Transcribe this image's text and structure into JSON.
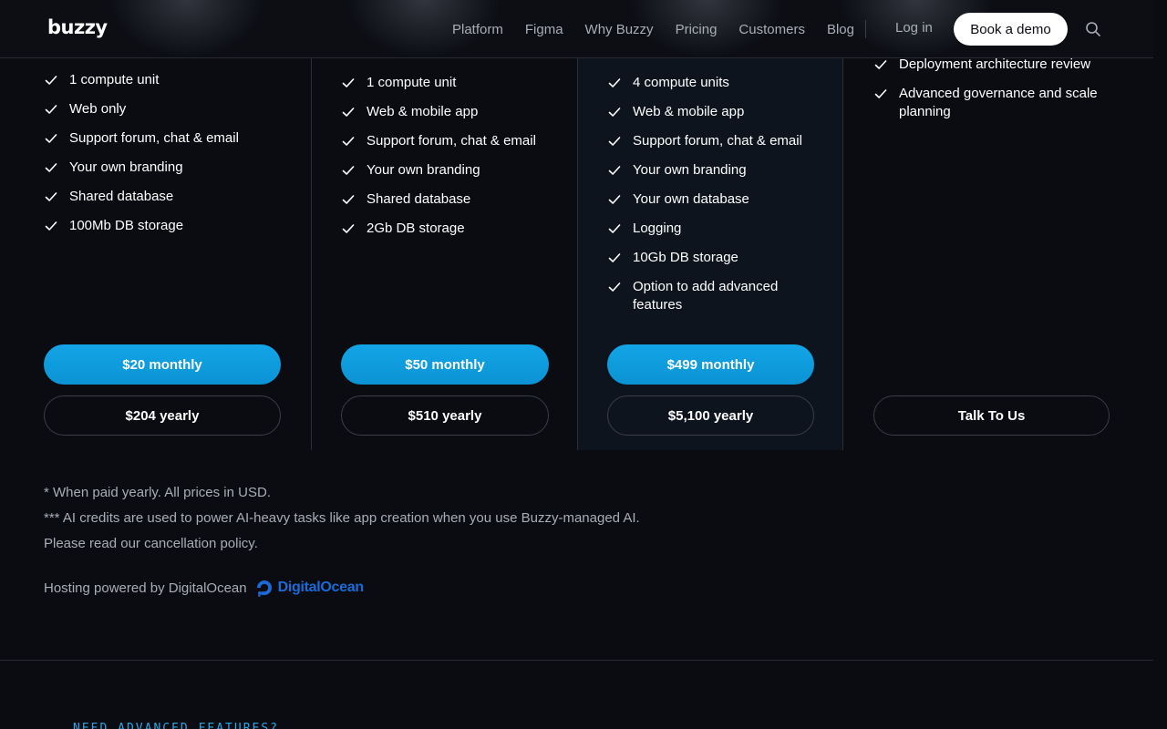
{
  "nav": {
    "logo": "buzzy",
    "links": [
      "Platform",
      "Figma",
      "Why Buzzy",
      "Pricing",
      "Customers",
      "Blog"
    ],
    "login": "Log in",
    "demo": "Book a demo",
    "search_icon": "search-icon"
  },
  "plans": [
    {
      "features": [
        "1 compute unit",
        "Web only",
        "Support forum, chat & email",
        "Your own branding",
        "Shared database",
        "100Mb DB storage"
      ],
      "monthly": "$20 monthly",
      "yearly": "$204 yearly"
    },
    {
      "features": [
        "1 compute unit",
        "Web & mobile app",
        "Support forum, chat & email",
        "Your own branding",
        "Shared database",
        "2Gb DB storage"
      ],
      "monthly": "$50 monthly",
      "yearly": "$510 yearly"
    },
    {
      "features": [
        "4 compute units",
        "Web & mobile app",
        "Support forum, chat & email",
        "Your own branding",
        "Your own database",
        "Logging",
        "10Gb DB storage",
        "Option to add advanced features"
      ],
      "monthly": "$499 monthly",
      "yearly": "$5,100 yearly"
    },
    {
      "features": [
        "Deployment architecture review",
        "Advanced governance and scale planning"
      ],
      "cta": "Talk To Us"
    }
  ],
  "footnotes": {
    "line1": "* When paid yearly. All prices in USD.",
    "line2": "*** AI credits are used to power AI-heavy tasks like app creation when you use Buzzy-managed AI.",
    "line3": "Please read our cancellation policy.",
    "hosting": "Hosting powered by DigitalOcean",
    "hosting_logo": "DigitalOcean"
  },
  "next_section": {
    "eyebrow": "NEED ADVANCED FEATURES?"
  },
  "colors": {
    "background": "#0a0c12",
    "accent": "#0ea5e9",
    "muted_text": "#a9adb6",
    "digitalocean_blue": "#1a6ad8"
  }
}
